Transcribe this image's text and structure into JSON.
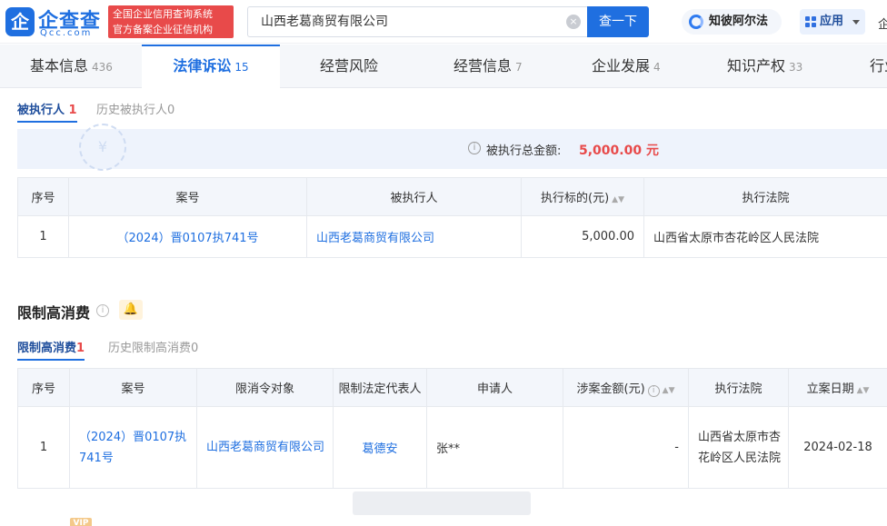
{
  "header": {
    "logo_mark": "企",
    "logo_text": "企查查",
    "logo_sub": "Qcc.com",
    "badge_line1": "全国企业信用查询系统",
    "badge_line2": "官方备案企业征信机构",
    "search_value": "山西老葛商贸有限公司",
    "search_button": "查一下",
    "zhibi_label": "知彼阿尔法",
    "app_label": "应用",
    "edge_text": "企"
  },
  "tabs": [
    {
      "label": "基本信息",
      "count": "436"
    },
    {
      "label": "法律诉讼",
      "count": "15"
    },
    {
      "label": "经营风险",
      "count": ""
    },
    {
      "label": "经营信息",
      "count": "7"
    },
    {
      "label": "企业发展",
      "count": "4"
    },
    {
      "label": "知识产权",
      "count": "33"
    },
    {
      "label": "行业",
      "count": ""
    }
  ],
  "executed": {
    "subtab_active": "被执行人",
    "subtab_active_count": "1",
    "subtab_history": "历史被执行人",
    "subtab_history_count": "0",
    "summary_seal": "¥",
    "summary_label": "被执行总金额:",
    "summary_value": "5,000.00 元",
    "headers": [
      "序号",
      "案号",
      "被执行人",
      "执行标的(元)",
      "执行法院"
    ],
    "rows": [
      {
        "no": "1",
        "case": "（2024）晋0107执741号",
        "party": "山西老葛商贸有限公司",
        "amount": "5,000.00",
        "court": "山西省太原市杏花岭区人民法院"
      }
    ]
  },
  "restriction": {
    "title": "限制高消费",
    "subtab_active": "限制高消费",
    "subtab_active_count": "1",
    "subtab_history": "历史限制高消费",
    "subtab_history_count": "0",
    "headers": [
      "序号",
      "案号",
      "限消令对象",
      "限制法定代表人",
      "申请人",
      "涉案金额(元)",
      "执行法院",
      "立案日期"
    ],
    "rows": [
      {
        "no": "1",
        "case": "（2024）晋0107执741号",
        "target": "山西老葛商贸有限公司",
        "rep": "葛德安",
        "applicant": "张**",
        "amount": "-",
        "court": "山西省太原市杏花岭区人民法院",
        "date": "2024-02-18"
      }
    ]
  },
  "footer": {
    "vip": "VIP"
  }
}
